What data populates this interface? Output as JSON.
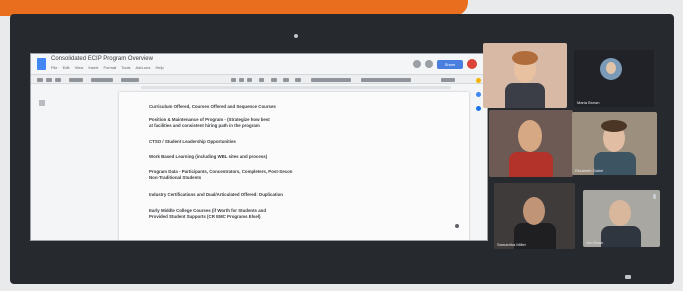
{
  "docs": {
    "title": "Consolidated ECIP Program Overview",
    "menu": [
      "File",
      "Edit",
      "View",
      "Insert",
      "Format",
      "Tools",
      "Add-ons",
      "Help"
    ],
    "share_label": "Share",
    "lines": [
      "Curriculum Offered, Courses Offered and Sequence Courses",
      "Position & Maintenance of Program - (Strategize how best",
      "at facilities and consistent hiring path in the program",
      "CTSO / Student Leadership Opportunities",
      "Work Based Learning (including WBL sites and process)",
      "Program Data - Participants, Concentrators, Completers, Post-Secon",
      "Non-Traditional Students",
      "Industry Certifications and Dual/Articulated Offered: Duplication",
      "Early Middle College Courses (if Worth for Students and",
      "Provided Student Supports (CR EMC Programs Elsel)"
    ]
  },
  "meeting": {
    "participants": [
      {
        "name": ""
      },
      {
        "name": "Maria Brown"
      },
      {
        "name": ""
      },
      {
        "name": "Elizabeth Gabel"
      },
      {
        "name": "Samantha Miller"
      },
      {
        "name": "Jon Dean"
      }
    ]
  },
  "colors": {
    "banner": "#e96f1f",
    "share_button": "#4a7fe0",
    "avatar_bg": "#7a9ab8"
  }
}
